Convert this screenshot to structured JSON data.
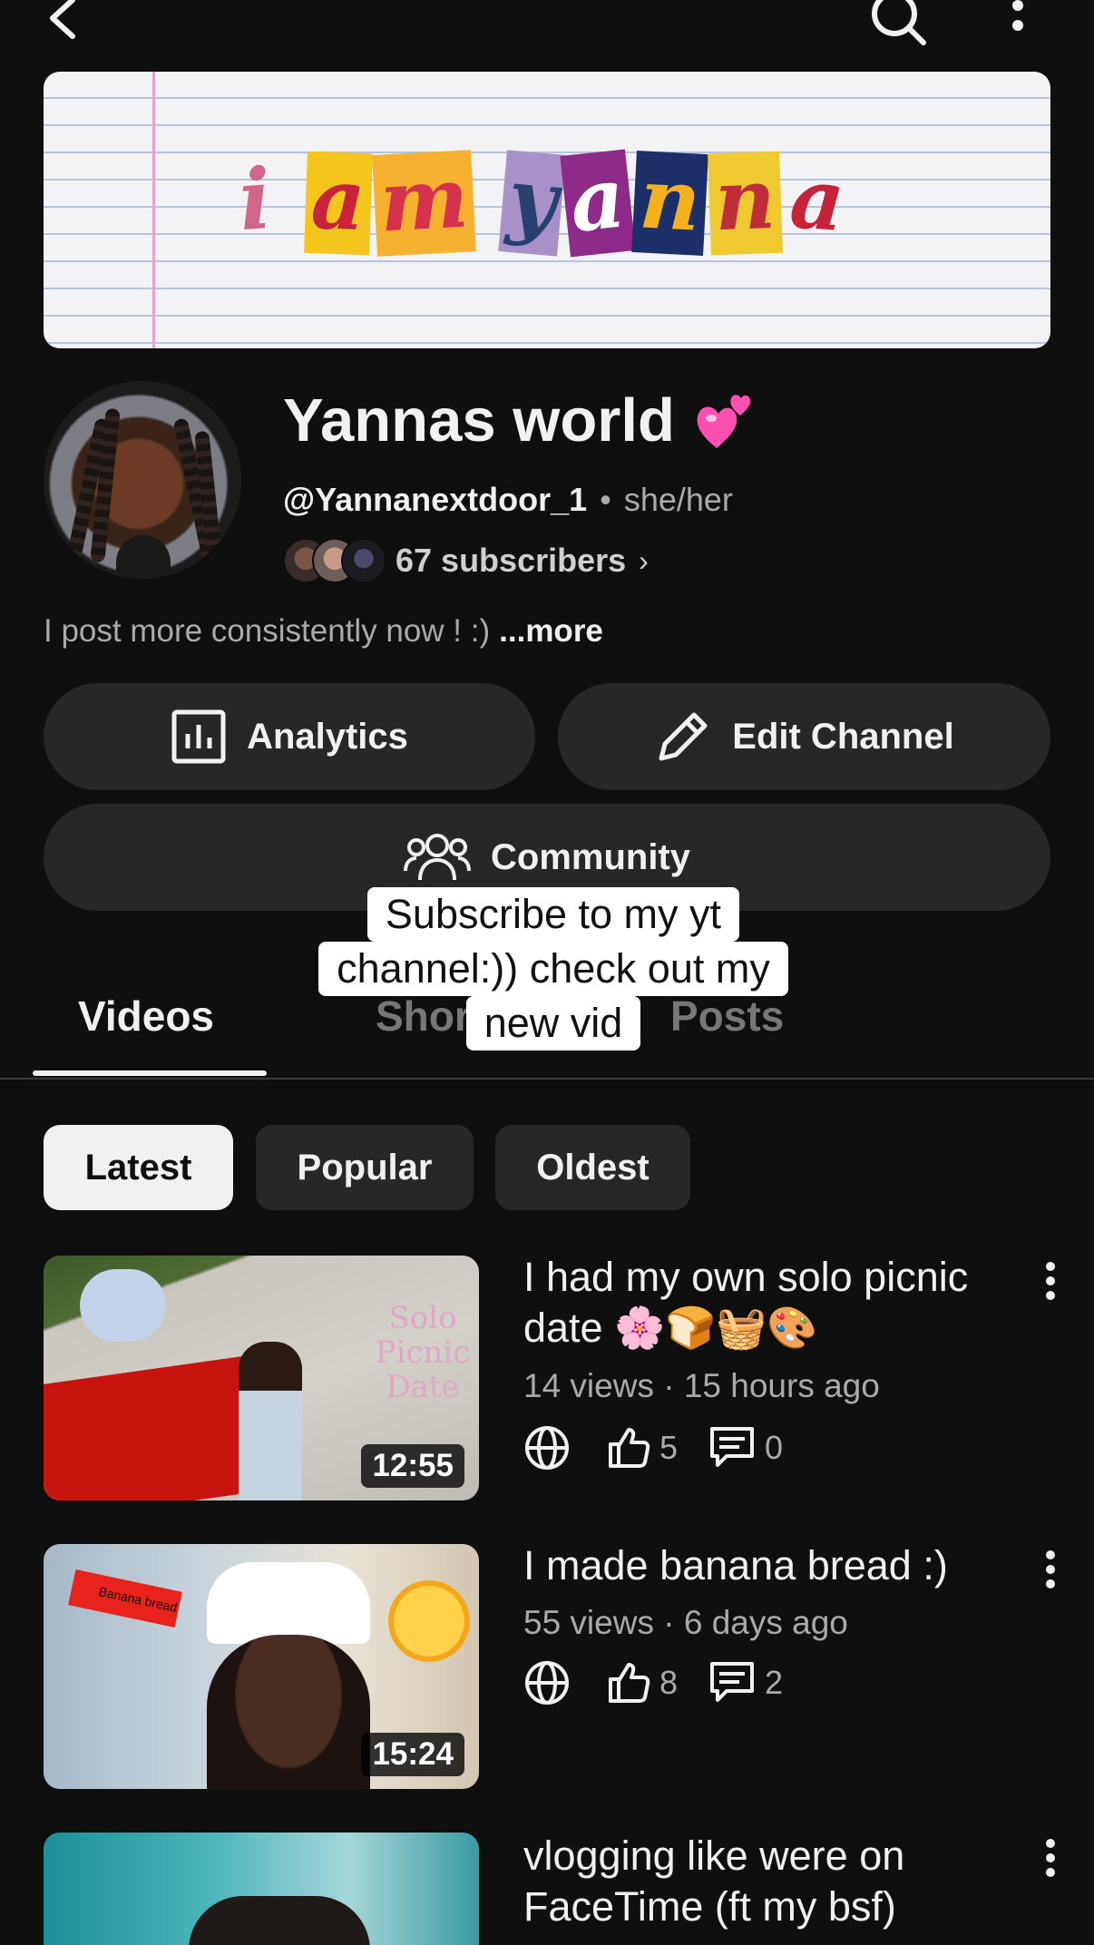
{
  "header": {
    "back_icon": "chevron-left-icon",
    "search_icon": "search-icon",
    "more_icon": "more-vertical-icon"
  },
  "banner": {
    "letters": [
      "i",
      "a",
      "m",
      "y",
      "a",
      "n",
      "n",
      "a"
    ],
    "letter_colors": [
      {
        "bg": "transparent",
        "fg": "#d0678b"
      },
      {
        "bg": "#f4c51c",
        "fg": "#c8233b"
      },
      {
        "bg": "#f6b130",
        "fg": "#d6324e"
      },
      {
        "bg": "#a890c9",
        "fg": "#27406d"
      },
      {
        "bg": "#8e2a87",
        "fg": "#ffffff"
      },
      {
        "bg": "#1c2f68",
        "fg": "#f3b11d"
      },
      {
        "bg": "#f0c830",
        "fg": "#bf2d3a"
      },
      {
        "bg": "transparent",
        "fg": "#c6233a"
      }
    ]
  },
  "channel": {
    "name": "Yannas world",
    "emoji_icon": "two-hearts-icon",
    "handle": "@Yannanextdoor_1",
    "pronouns": "she/her",
    "subscribers": "67 subscribers",
    "description": "I post more consistently now ! :)",
    "more_label": "...more"
  },
  "buttons": {
    "analytics": "Analytics",
    "edit_channel": "Edit Channel",
    "community": "Community"
  },
  "tabs": {
    "videos": "Videos",
    "shorts": "Shorts",
    "posts": "Posts"
  },
  "caption": {
    "line1": "Subscribe to my yt",
    "line2": "channel:)) check out my",
    "line3": "new vid"
  },
  "chips": {
    "latest": "Latest",
    "popular": "Popular",
    "oldest": "Oldest"
  },
  "videos": [
    {
      "title": "I had my own solo picnic date 🌸🍞🧺🎨",
      "meta": "14 views · 15 hours ago",
      "duration": "12:55",
      "likes": "5",
      "comments": "0",
      "thumb_text": "Solo Picnic Date"
    },
    {
      "title": "I made banana bread :)",
      "meta": "55 views · 6 days ago",
      "duration": "15:24",
      "likes": "8",
      "comments": "2",
      "thumb_text": "Banana bread"
    },
    {
      "title": "vlogging like were on FaceTime (ft my bsf)"
    }
  ],
  "colors": {
    "background": "#0f0f0f",
    "surface": "#272727",
    "text": "#f1f1f1",
    "muted": "#aaaaaa"
  }
}
